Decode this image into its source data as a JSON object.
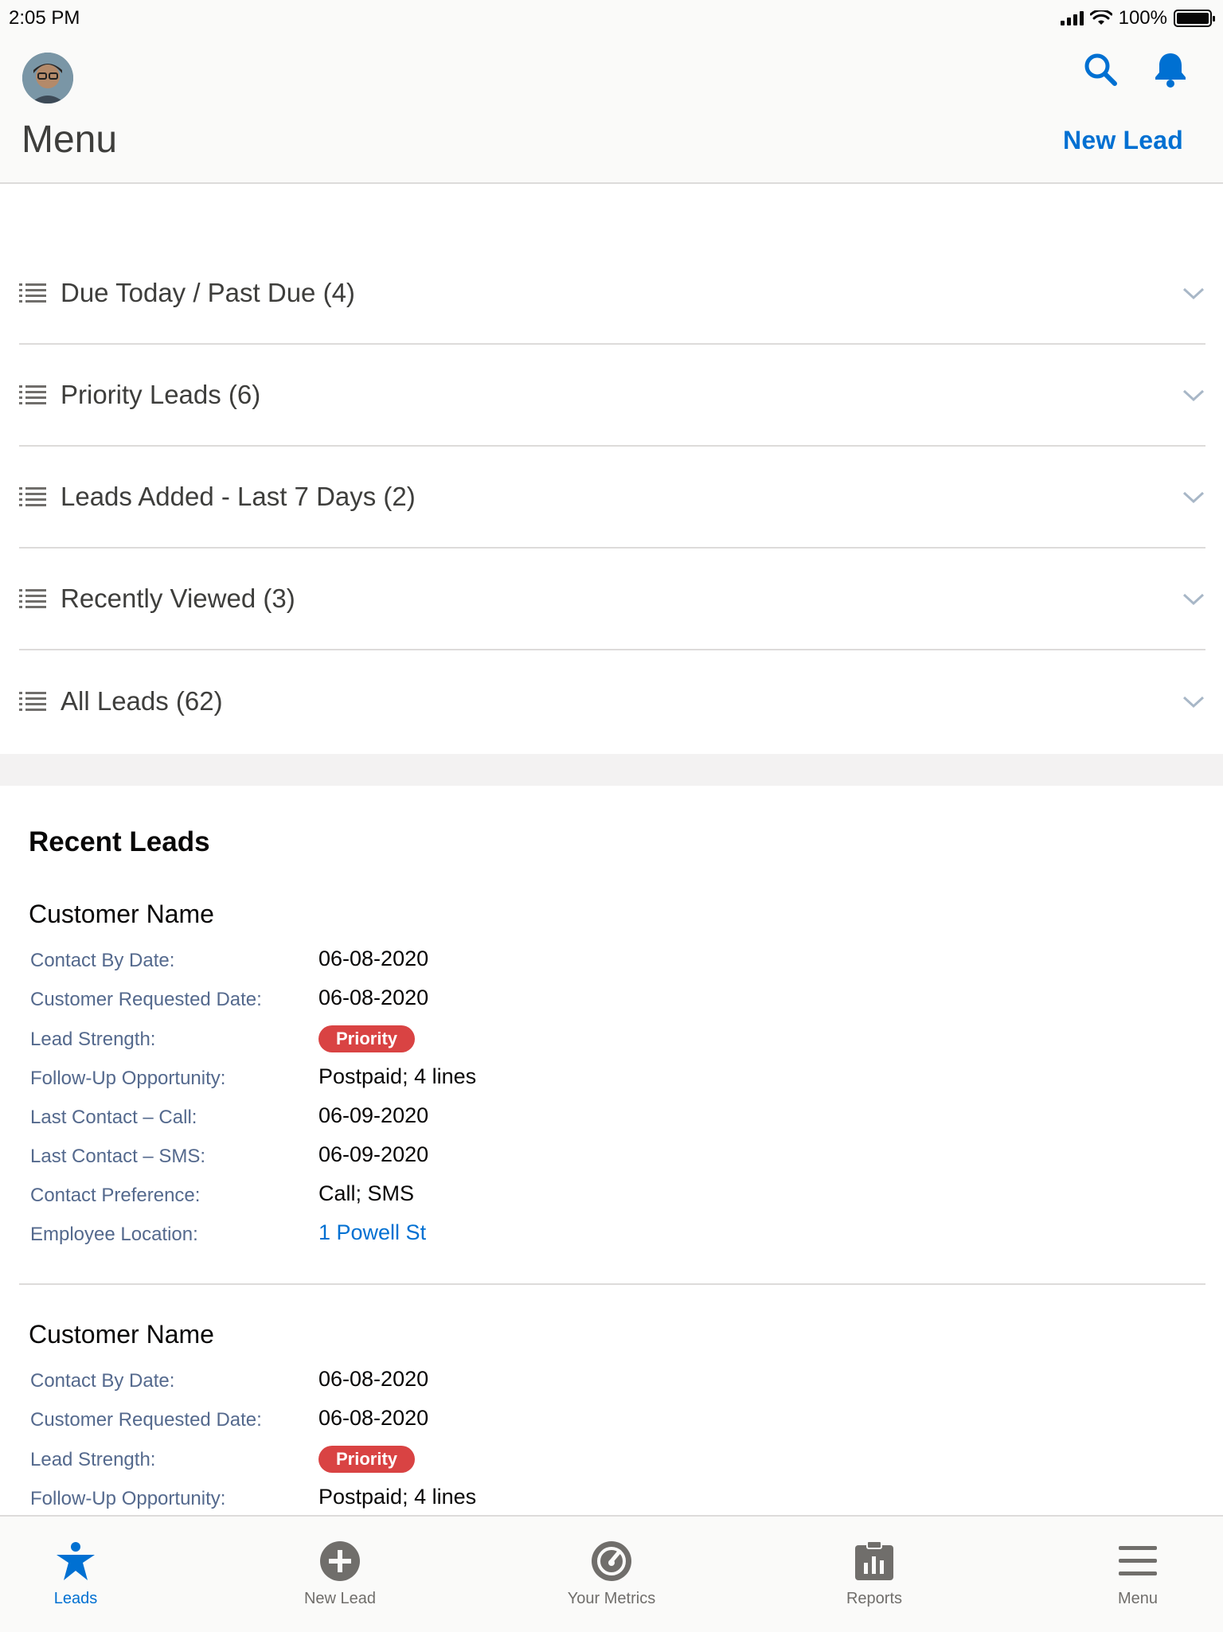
{
  "status_bar": {
    "time": "2:05 PM",
    "battery": "100%"
  },
  "header": {
    "title": "Menu",
    "new_lead_label": "New Lead"
  },
  "icons": {
    "search": "search-icon",
    "notifications": "bell-icon",
    "list": "list-icon",
    "chevron": "chevron-down-icon"
  },
  "colors": {
    "brand": "#0070d2",
    "priority_badge": "#d94343",
    "label_text": "#54698d"
  },
  "lists": [
    {
      "label": "Due Today / Past Due (4)"
    },
    {
      "label": "Priority Leads (6)"
    },
    {
      "label": "Leads Added - Last 7 Days (2)"
    },
    {
      "label": "Recently Viewed (3)"
    },
    {
      "label": "All Leads (62)"
    }
  ],
  "recent_leads": {
    "title": "Recent Leads",
    "cards": [
      {
        "name": "Customer Name",
        "fields": [
          {
            "label": "Contact By Date:",
            "value": "06-08-2020"
          },
          {
            "label": "Customer Requested Date:",
            "value": "06-08-2020"
          },
          {
            "label": "Lead Strength:",
            "value": "Priority"
          },
          {
            "label": "Follow-Up Opportunity:",
            "value": "Postpaid; 4 lines"
          },
          {
            "label": "Last Contact – Call:",
            "value": "06-09-2020"
          },
          {
            "label": "Last Contact – SMS:",
            "value": "06-09-2020"
          },
          {
            "label": "Contact Preference:",
            "value": "Call; SMS"
          },
          {
            "label": "Employee Location:",
            "value": "1 Powell St"
          }
        ]
      },
      {
        "name": "Customer Name",
        "fields": [
          {
            "label": "Contact By Date:",
            "value": "06-08-2020"
          },
          {
            "label": "Customer Requested Date:",
            "value": "06-08-2020"
          },
          {
            "label": "Lead Strength:",
            "value": "Priority"
          },
          {
            "label": "Follow-Up Opportunity:",
            "value": "Postpaid; 4 lines"
          }
        ]
      }
    ]
  },
  "tabs": [
    {
      "label": "Leads",
      "icon": "star-person-icon",
      "active": true
    },
    {
      "label": "New Lead",
      "icon": "plus-circle-icon",
      "active": false
    },
    {
      "label": "Your Metrics",
      "icon": "gauge-icon",
      "active": false
    },
    {
      "label": "Reports",
      "icon": "reports-icon",
      "active": false
    },
    {
      "label": "Menu",
      "icon": "hamburger-icon",
      "active": false
    }
  ]
}
